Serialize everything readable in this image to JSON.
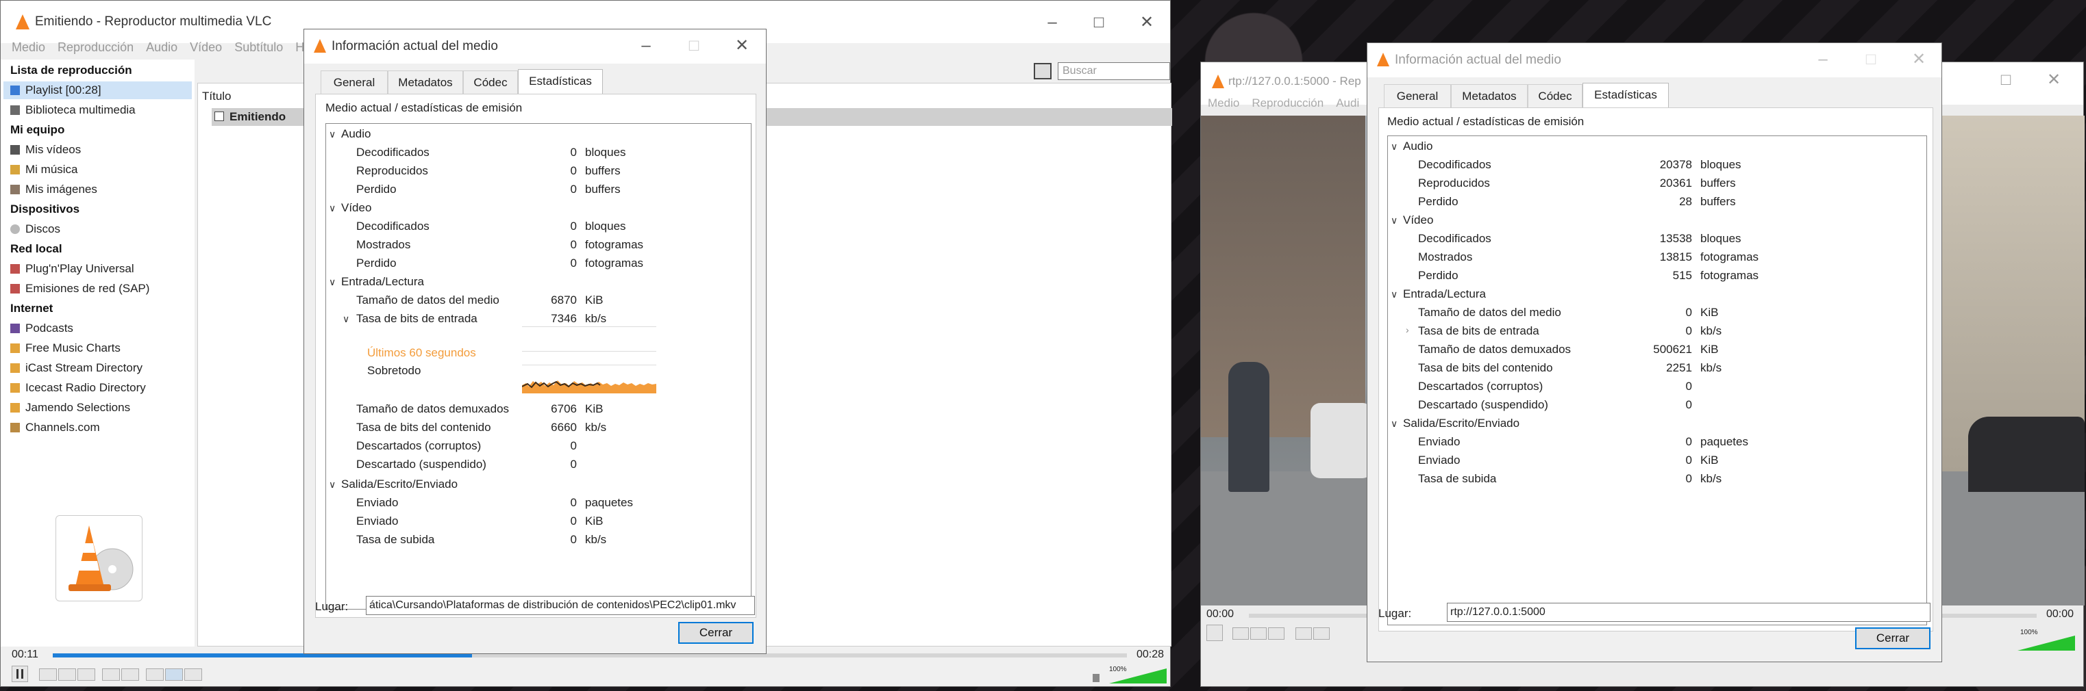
{
  "vlc_main": {
    "title": "Emitiendo - Reproductor multimedia VLC",
    "menu": [
      "Medio",
      "Reproducción",
      "Audio",
      "Vídeo",
      "Subtítulo",
      "H"
    ],
    "search_placeholder": "Buscar",
    "playlist_sections": [
      {
        "header": "Lista de reproducción",
        "items": [
          "Playlist [00:28]",
          "Biblioteca multimedia"
        ]
      },
      {
        "header": "Mi equipo",
        "items": [
          "Mis vídeos",
          "Mi música",
          "Mis imágenes"
        ]
      },
      {
        "header": "Dispositivos",
        "items": [
          "Discos"
        ]
      },
      {
        "header": "Red local",
        "items": [
          "Plug'n'Play Universal",
          "Emisiones de red (SAP)"
        ]
      },
      {
        "header": "Internet",
        "items": [
          "Podcasts",
          "Free Music Charts",
          "iCast Stream Directory",
          "Icecast Radio Directory",
          "Jamendo Selections",
          "Channels.com"
        ]
      }
    ],
    "column_header": "Título",
    "current_row": "Emitiendo",
    "time_elapsed": "00:11",
    "time_total": "00:28",
    "progress": 0.39,
    "volume_label": "100%"
  },
  "info_left": {
    "title": "Información actual del medio",
    "tabs": [
      "General",
      "Metadatos",
      "Códec",
      "Estadísticas"
    ],
    "active_tab": "Estadísticas",
    "section_label": "Medio actual / estadísticas de emisión",
    "audio": {
      "label": "Audio",
      "rows": [
        [
          "Decodificados",
          "0",
          "bloques"
        ],
        [
          "Reproducidos",
          "0",
          "buffers"
        ],
        [
          "Perdido",
          "0",
          "buffers"
        ]
      ]
    },
    "video": {
      "label": "Vídeo",
      "rows": [
        [
          "Decodificados",
          "0",
          "bloques"
        ],
        [
          "Mostrados",
          "0",
          "fotogramas"
        ],
        [
          "Perdido",
          "0",
          "fotogramas"
        ]
      ]
    },
    "input": {
      "label": "Entrada/Lectura",
      "rows": [
        [
          "Tamaño de datos del medio",
          "6870",
          "KiB"
        ],
        [
          "Tasa de bits de entrada",
          "7346",
          "kb/s"
        ]
      ]
    },
    "graph_legend_1": "Últimos 60 segundos",
    "graph_legend_2": "Sobretodo",
    "input_rows_2": [
      [
        "Tamaño de datos demuxados",
        "6706",
        "KiB"
      ],
      [
        "Tasa de bits del contenido",
        "6660",
        "kb/s"
      ],
      [
        "Descartados (corruptos)",
        "0",
        ""
      ],
      [
        "Descartado (suspendido)",
        "0",
        ""
      ]
    ],
    "output": {
      "label": "Salida/Escrito/Enviado",
      "rows": [
        [
          "Enviado",
          "0",
          "paquetes"
        ],
        [
          "Enviado",
          "0",
          "KiB"
        ],
        [
          "Tasa de subida",
          "0",
          "kb/s"
        ]
      ]
    },
    "location_label": "Lugar:",
    "location_value": "ática\\Cursando\\Plataformas de distribución de contenidos\\PEC2\\clip01.mkv",
    "close_label": "Cerrar"
  },
  "vlc_right": {
    "title": "rtp://127.0.0.1:5000 - Rep",
    "menu": [
      "Medio",
      "Reproducción",
      "Audi"
    ],
    "time_elapsed": "00:00",
    "time_total": "00:00",
    "volume_label": "100%"
  },
  "info_right": {
    "title": "Información actual del medio",
    "tabs": [
      "General",
      "Metadatos",
      "Códec",
      "Estadísticas"
    ],
    "active_tab": "Estadísticas",
    "section_label": "Medio actual / estadísticas de emisión",
    "audio": {
      "label": "Audio",
      "rows": [
        [
          "Decodificados",
          "20378",
          "bloques"
        ],
        [
          "Reproducidos",
          "20361",
          "buffers"
        ],
        [
          "Perdido",
          "28",
          "buffers"
        ]
      ]
    },
    "video": {
      "label": "Vídeo",
      "rows": [
        [
          "Decodificados",
          "13538",
          "bloques"
        ],
        [
          "Mostrados",
          "13815",
          "fotogramas"
        ],
        [
          "Perdido",
          "515",
          "fotogramas"
        ]
      ]
    },
    "input": {
      "label": "Entrada/Lectura",
      "rows": [
        [
          "Tamaño de datos del medio",
          "0",
          "KiB"
        ],
        [
          "Tasa de bits de entrada",
          "0",
          "kb/s"
        ],
        [
          "Tamaño de datos demuxados",
          "500621",
          "KiB"
        ],
        [
          "Tasa de bits del contenido",
          "2251",
          "kb/s"
        ],
        [
          "Descartados (corruptos)",
          "0",
          ""
        ],
        [
          "Descartado (suspendido)",
          "0",
          ""
        ]
      ]
    },
    "output": {
      "label": "Salida/Escrito/Enviado",
      "rows": [
        [
          "Enviado",
          "0",
          "paquetes"
        ],
        [
          "Enviado",
          "0",
          "KiB"
        ],
        [
          "Tasa de subida",
          "0",
          "kb/s"
        ]
      ]
    },
    "location_label": "Lugar:",
    "location_value": "rtp://127.0.0.1:5000",
    "close_label": "Cerrar"
  },
  "colors": {
    "accent": "#0078d7",
    "graph": "#f39c3b",
    "vlc_orange": "#f58220",
    "volume": "#26c22e"
  }
}
